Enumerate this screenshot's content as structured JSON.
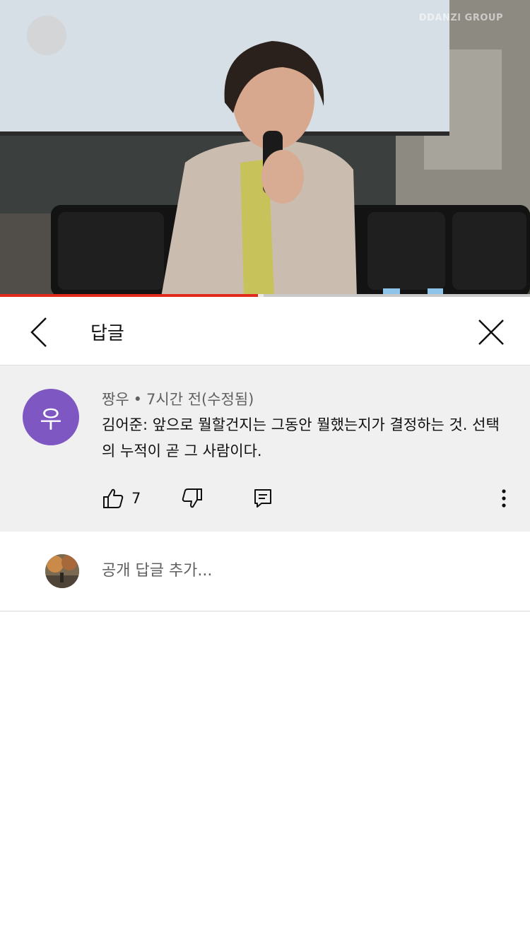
{
  "video": {
    "watermark": "DDANZI GROUP",
    "progress_fraction": 0.487,
    "buffer_fraction": 0.01,
    "accent_color": "#e1291e"
  },
  "header": {
    "title": "답글",
    "back_icon": "chevron-left-icon",
    "close_icon": "close-icon"
  },
  "comment": {
    "avatar_letter": "우",
    "avatar_color": "#7e57c2",
    "author": "짱우",
    "separator": "•",
    "time": "7시간 전(수정됨)",
    "text": "김어준: 앞으로 뭘할건지는 그동안 뭘했는지가 결정하는 것. 선택의 누적이 곧 그 사람이다.",
    "like_count": "7"
  },
  "reply": {
    "placeholder": "공개 답글 추가..."
  }
}
